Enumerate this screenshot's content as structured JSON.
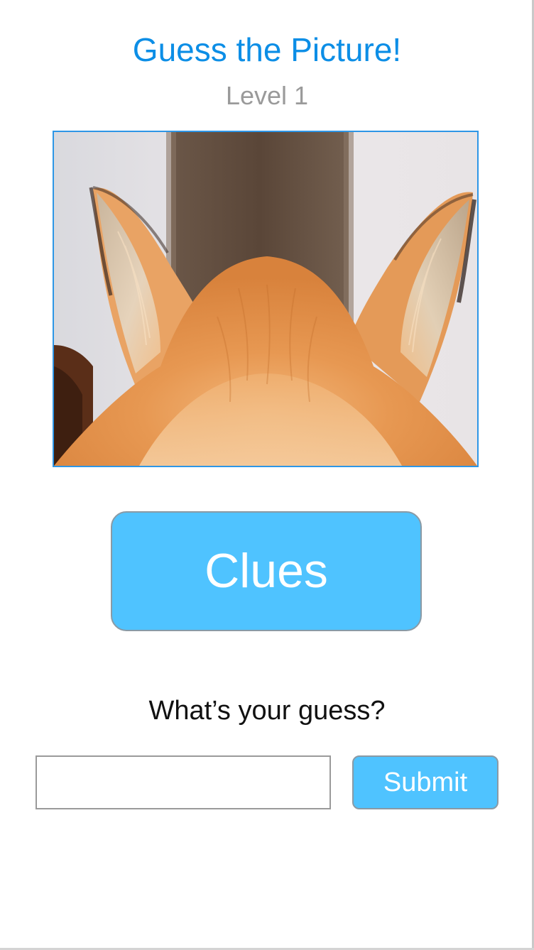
{
  "header": {
    "title": "Guess the Picture!",
    "level": "Level 1"
  },
  "puzzle": {
    "image_subject_icon": "fox-ears-closeup-image"
  },
  "clues_button": {
    "label": "Clues"
  },
  "guess": {
    "prompt": "What’s your guess?",
    "input_value": "",
    "input_placeholder": "",
    "submit_label": "Submit"
  },
  "colors": {
    "title": "#0c8ee6",
    "level": "#9a9a9a",
    "button_fill": "#4fc3ff",
    "button_border": "#8a9aa5",
    "image_border": "#2e96e6"
  }
}
